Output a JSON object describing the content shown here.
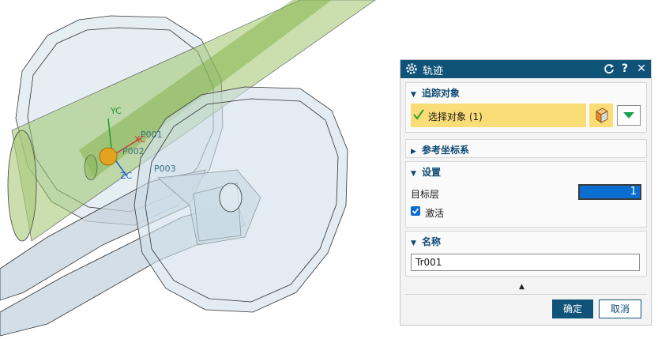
{
  "viewport": {
    "axis_labels": {
      "yc": "YC",
      "xc": "XC",
      "zc": "ZC"
    },
    "point_labels": {
      "p1": "P001",
      "p2": "P002",
      "p3": "P003"
    }
  },
  "dialog": {
    "title": "轨迹",
    "icons": {
      "settings": "gear-icon",
      "reset": "reset-icon",
      "help": "help-icon",
      "close": "close-icon"
    },
    "help_symbol": "?",
    "close_symbol": "✕",
    "sections": {
      "trace_object": {
        "header": "追踪对象",
        "select_label": "选择对象 (1)"
      },
      "reference_csys": {
        "header": "参考坐标系"
      },
      "settings": {
        "header": "设置",
        "target_layer_label": "目标层",
        "target_layer_value": "1",
        "active_label": "激活",
        "active_checked": true
      },
      "name": {
        "header": "名称",
        "value": "Tr001"
      }
    },
    "buttons": {
      "ok": "确定",
      "cancel": "取消"
    },
    "colors": {
      "titlebar": "#0f5478",
      "selection_highlight": "#fbdd77",
      "accent": "#0a6ed1"
    }
  }
}
